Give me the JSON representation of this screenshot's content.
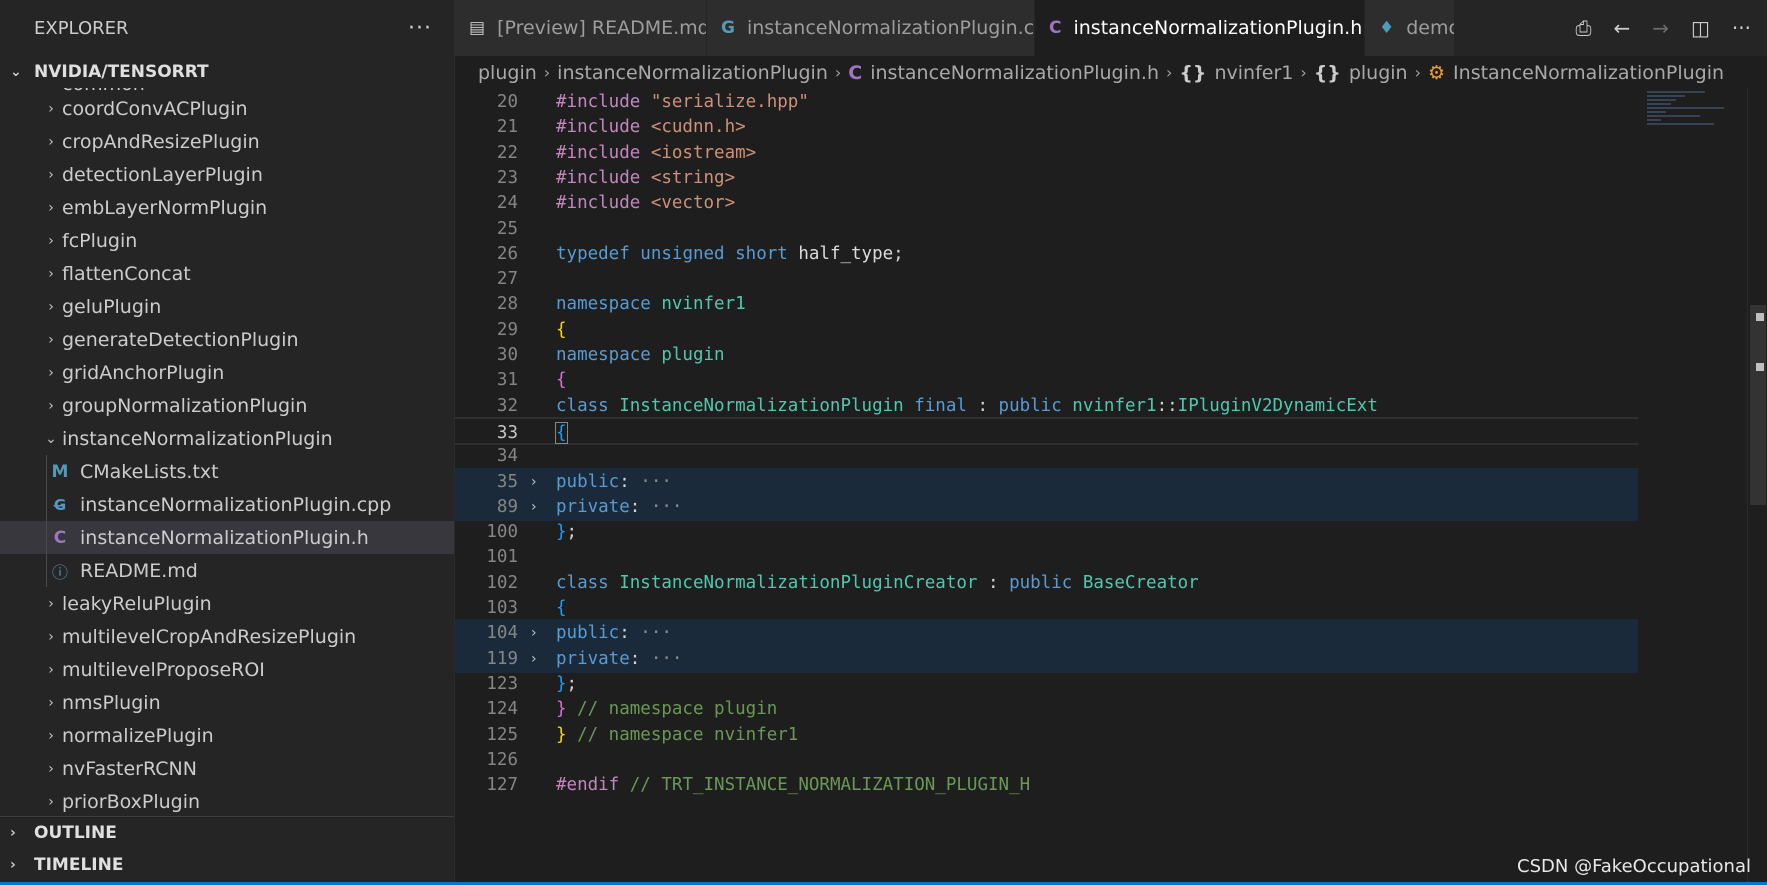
{
  "explorer": {
    "title": "EXPLORER",
    "more": "···",
    "root": "NVIDIA/TENSORRT",
    "partial_top": "common",
    "items": [
      {
        "type": "folder",
        "label": "coordConvACPlugin",
        "expanded": false
      },
      {
        "type": "folder",
        "label": "cropAndResizePlugin",
        "expanded": false
      },
      {
        "type": "folder",
        "label": "detectionLayerPlugin",
        "expanded": false
      },
      {
        "type": "folder",
        "label": "embLayerNormPlugin",
        "expanded": false
      },
      {
        "type": "folder",
        "label": "fcPlugin",
        "expanded": false
      },
      {
        "type": "folder",
        "label": "flattenConcat",
        "expanded": false
      },
      {
        "type": "folder",
        "label": "geluPlugin",
        "expanded": false
      },
      {
        "type": "folder",
        "label": "generateDetectionPlugin",
        "expanded": false
      },
      {
        "type": "folder",
        "label": "gridAnchorPlugin",
        "expanded": false
      },
      {
        "type": "folder",
        "label": "groupNormalizationPlugin",
        "expanded": false
      },
      {
        "type": "folder",
        "label": "instanceNormalizationPlugin",
        "expanded": true
      },
      {
        "type": "file",
        "icon": "M",
        "label": "CMakeLists.txt"
      },
      {
        "type": "file",
        "icon": "G",
        "label": "instanceNormalizationPlugin.cpp"
      },
      {
        "type": "file",
        "icon": "C",
        "label": "instanceNormalizationPlugin.h",
        "selected": true
      },
      {
        "type": "file",
        "icon": "i",
        "label": "README.md"
      },
      {
        "type": "folder",
        "label": "leakyReluPlugin",
        "expanded": false
      },
      {
        "type": "folder",
        "label": "multilevelCropAndResizePlugin",
        "expanded": false
      },
      {
        "type": "folder",
        "label": "multilevelProposeROI",
        "expanded": false
      },
      {
        "type": "folder",
        "label": "nmsPlugin",
        "expanded": false
      },
      {
        "type": "folder",
        "label": "normalizePlugin",
        "expanded": false
      },
      {
        "type": "folder",
        "label": "nvFasterRCNN",
        "expanded": false
      },
      {
        "type": "folder",
        "label": "priorBoxPlugin",
        "expanded": false
      }
    ],
    "outline": "OUTLINE",
    "timeline": "TIMELINE"
  },
  "tabs": [
    {
      "label": "[Preview] README.md",
      "icon": "▤",
      "active": false
    },
    {
      "label": "instanceNormalizationPlugin.cpp",
      "icon": "G",
      "active": false
    },
    {
      "label": "instanceNormalizationPlugin.h",
      "icon": "C",
      "active": true
    },
    {
      "label": "demc",
      "icon": "♦",
      "active": false
    }
  ],
  "breadcrumbs": [
    "plugin",
    "instanceNormalizationPlugin",
    "instanceNormalizationPlugin.h",
    "nvinfer1",
    "plugin",
    "InstanceNormalizationPlugin"
  ],
  "code": {
    "lines": [
      {
        "n": "20",
        "tokens": [
          [
            "kw",
            "#include "
          ],
          [
            "str",
            "\"serialize.hpp\""
          ]
        ]
      },
      {
        "n": "21",
        "tokens": [
          [
            "kw",
            "#include "
          ],
          [
            "str",
            "<cudnn.h>"
          ]
        ]
      },
      {
        "n": "22",
        "tokens": [
          [
            "kw",
            "#include "
          ],
          [
            "str",
            "<iostream>"
          ]
        ]
      },
      {
        "n": "23",
        "tokens": [
          [
            "kw",
            "#include "
          ],
          [
            "str",
            "<string>"
          ]
        ]
      },
      {
        "n": "24",
        "tokens": [
          [
            "kw",
            "#include "
          ],
          [
            "str",
            "<vector>"
          ]
        ]
      },
      {
        "n": "25",
        "tokens": []
      },
      {
        "n": "26",
        "tokens": [
          [
            "kb",
            "typedef "
          ],
          [
            "kb",
            "unsigned "
          ],
          [
            "kb",
            "short "
          ],
          [
            "id",
            "half_type"
          ],
          [
            "pn",
            ";"
          ]
        ]
      },
      {
        "n": "27",
        "tokens": []
      },
      {
        "n": "28",
        "tokens": [
          [
            "kb",
            "namespace "
          ],
          [
            "ty",
            "nvinfer1"
          ]
        ]
      },
      {
        "n": "29",
        "tokens": [
          [
            "br1",
            "{"
          ]
        ]
      },
      {
        "n": "30",
        "tokens": [
          [
            "kb",
            "namespace "
          ],
          [
            "ty",
            "plugin"
          ]
        ]
      },
      {
        "n": "31",
        "tokens": [
          [
            "br2",
            "{"
          ]
        ]
      },
      {
        "n": "32",
        "tokens": [
          [
            "kb",
            "class "
          ],
          [
            "ty",
            "InstanceNormalizationPlugin "
          ],
          [
            "kb",
            "final "
          ],
          [
            "pn",
            ": "
          ],
          [
            "kb",
            "public "
          ],
          [
            "ty",
            "nvinfer1"
          ],
          [
            "pn",
            "::"
          ],
          [
            "ty",
            "IPluginV2DynamicExt"
          ]
        ]
      },
      {
        "n": "33",
        "tokens": [
          [
            "br3",
            "{"
          ]
        ],
        "current": true
      },
      {
        "n": "34",
        "tokens": []
      },
      {
        "n": "35",
        "tokens": [
          [
            "kb",
            "public"
          ],
          [
            "pn",
            ":"
          ],
          [
            "dots",
            " ···"
          ]
        ],
        "folded": true
      },
      {
        "n": "89",
        "tokens": [
          [
            "kb",
            "private"
          ],
          [
            "pn",
            ":"
          ],
          [
            "dots",
            " ···"
          ]
        ],
        "folded": true
      },
      {
        "n": "100",
        "tokens": [
          [
            "br3",
            "}"
          ],
          [
            "pn",
            ";"
          ]
        ]
      },
      {
        "n": "101",
        "tokens": []
      },
      {
        "n": "102",
        "tokens": [
          [
            "kb",
            "class "
          ],
          [
            "ty",
            "InstanceNormalizationPluginCreator "
          ],
          [
            "pn",
            ": "
          ],
          [
            "kb",
            "public "
          ],
          [
            "ty",
            "BaseCreator"
          ]
        ]
      },
      {
        "n": "103",
        "tokens": [
          [
            "br3",
            "{"
          ]
        ]
      },
      {
        "n": "104",
        "tokens": [
          [
            "kb",
            "public"
          ],
          [
            "pn",
            ":"
          ],
          [
            "dots",
            " ···"
          ]
        ],
        "folded": true
      },
      {
        "n": "119",
        "tokens": [
          [
            "kb",
            "private"
          ],
          [
            "pn",
            ":"
          ],
          [
            "dots",
            " ···"
          ]
        ],
        "folded": true
      },
      {
        "n": "123",
        "tokens": [
          [
            "br3",
            "}"
          ],
          [
            "pn",
            ";"
          ]
        ]
      },
      {
        "n": "124",
        "tokens": [
          [
            "br2",
            "} "
          ],
          [
            "cm",
            "// namespace plugin"
          ]
        ]
      },
      {
        "n": "125",
        "tokens": [
          [
            "br1",
            "} "
          ],
          [
            "cm",
            "// namespace nvinfer1"
          ]
        ]
      },
      {
        "n": "126",
        "tokens": []
      },
      {
        "n": "127",
        "tokens": [
          [
            "kw",
            "#endif "
          ],
          [
            "cm",
            "// TRT_INSTANCE_NORMALIZATION_PLUGIN_H"
          ]
        ]
      }
    ]
  },
  "watermark": "CSDN @FakeOccupational",
  "colors": {
    "accent": "#007acc",
    "selection": "#37373d",
    "folded_bg": "#1b2a3a"
  }
}
